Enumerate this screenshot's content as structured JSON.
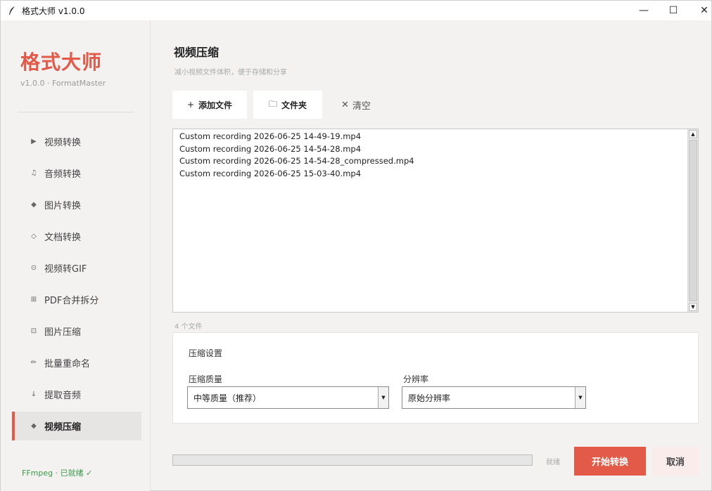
{
  "window": {
    "title": "格式大师 v1.0.0",
    "controls": {
      "minimize": "—",
      "maximize": "☐",
      "close": "✕"
    }
  },
  "brand": {
    "logo": "格式大师",
    "version": "v1.0.0 · FormatMaster",
    "accent": "#e35a48"
  },
  "sidebar": {
    "items": [
      {
        "icon": "▶",
        "icon_name": "play-icon",
        "label": "视频转换"
      },
      {
        "icon": "♫",
        "icon_name": "music-note-icon",
        "label": "音频转换"
      },
      {
        "icon": "◆",
        "icon_name": "diamond-icon",
        "label": "图片转换"
      },
      {
        "icon": "◇",
        "icon_name": "diamond-outline-icon",
        "label": "文档转换"
      },
      {
        "icon": "⊙",
        "icon_name": "circle-dot-icon",
        "label": "视频转GIF"
      },
      {
        "icon": "⊞",
        "icon_name": "grid-icon",
        "label": "PDF合并拆分"
      },
      {
        "icon": "⊡",
        "icon_name": "square-icon",
        "label": "图片压缩"
      },
      {
        "icon": "✏",
        "icon_name": "pencil-icon",
        "label": "批量重命名"
      },
      {
        "icon": "↓",
        "icon_name": "down-arrow-icon",
        "label": "提取音频"
      },
      {
        "icon": "◆",
        "icon_name": "diamond-icon",
        "label": "视频压缩",
        "active": true
      }
    ],
    "status": "FFmpeg · 已就绪 ✓"
  },
  "main": {
    "title": "视频压缩",
    "subtitle": "减小视频文件体积，便于存储和分享",
    "toolbar": {
      "add_file": {
        "icon": "+",
        "label": "添加文件"
      },
      "folder": {
        "icon": "🗀",
        "label": "文件夹"
      },
      "clear": {
        "icon": "✕",
        "label": "清空"
      }
    },
    "files": [
      "Custom recording 2026-06-25 14-49-19.mp4",
      "Custom recording 2026-06-25 14-54-28.mp4",
      "Custom recording 2026-06-25 14-54-28_compressed.mp4",
      "Custom recording 2026-06-25 15-03-40.mp4"
    ],
    "file_count": "4 个文件",
    "settings": {
      "title": "压缩设置",
      "quality": {
        "label": "压缩质量",
        "value": "中等质量（推荐）"
      },
      "resolution": {
        "label": "分辨率",
        "value": "原始分辨率"
      }
    },
    "progress": 0,
    "status": "就绪",
    "start_label": "开始转换",
    "cancel_label": "取消"
  }
}
